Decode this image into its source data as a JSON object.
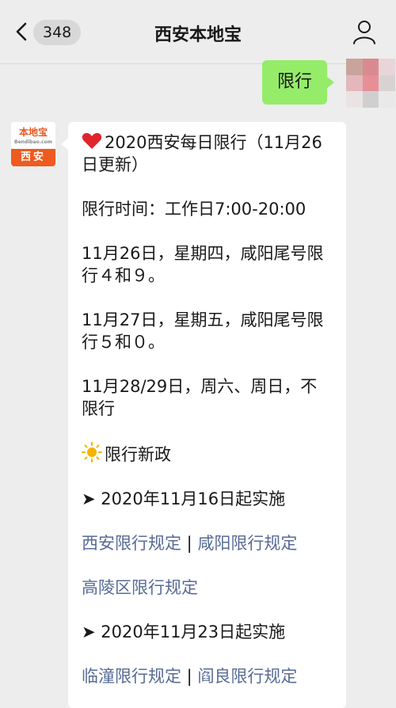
{
  "nav": {
    "unread_count": "348",
    "title": "西安本地宝"
  },
  "outgoing": {
    "text": "限行"
  },
  "bot": {
    "logo_text": "本地宝",
    "logo_sub": "Bendibao.com",
    "city": "西安"
  },
  "reply": {
    "heading": "2020西安每日限行（11月26日更新）",
    "time": "限行时间：工作日7:00-20:00",
    "day1": "11月26日，星期四，咸阳尾号限行４和９。",
    "day2": "11月27日，星期五，咸阳尾号限行５和０。",
    "day3": "11月28/29日，周六、周日，不限行",
    "new_policy": "限行新政",
    "section1": "➤ 2020年11月16日起实施",
    "link1": "西安限行规定",
    "divider": " | ",
    "link2": "咸阳限行规定",
    "link3": "高陵区限行规定",
    "section2": "➤ 2020年11月23日起实施",
    "link4": "临潼限行规定",
    "link5": "阎良限行规定"
  },
  "colors": {
    "outgoing_bubble": "#95ec69",
    "link": "#576b95",
    "brand_orange": "#ee5a1f",
    "heart": "#e0242b",
    "sun": "#f5b400"
  },
  "icons": {
    "back": "chevron-left-icon",
    "profile": "person-icon",
    "heart": "heart-icon",
    "sun": "sun-icon"
  }
}
